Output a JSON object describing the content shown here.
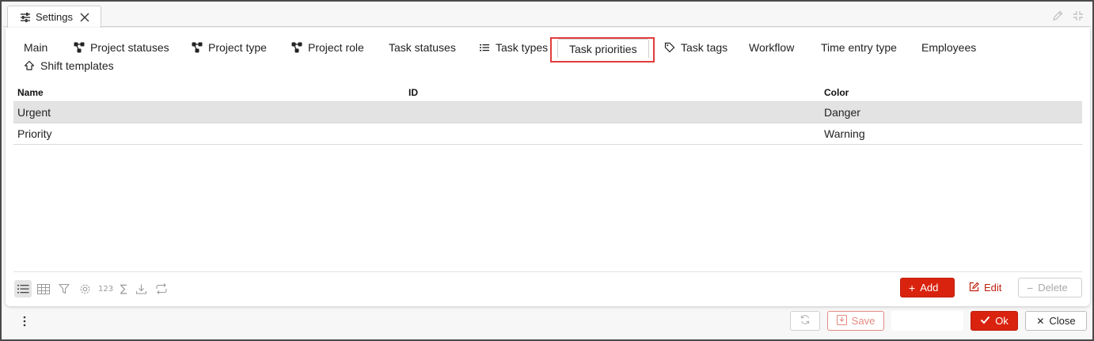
{
  "window": {
    "tab_title": "Settings"
  },
  "settings_tabs": [
    {
      "label": "Main",
      "icon": "none"
    },
    {
      "label": "Project statuses",
      "icon": "hierarchy-icon"
    },
    {
      "label": "Project type",
      "icon": "hierarchy-icon"
    },
    {
      "label": "Project role",
      "icon": "hierarchy-icon"
    },
    {
      "label": "Task statuses",
      "icon": "none"
    },
    {
      "label": "Task types",
      "icon": "list-icon"
    },
    {
      "label": "Task priorities",
      "icon": "none",
      "active": true
    },
    {
      "label": "Task tags",
      "icon": "tag-icon"
    },
    {
      "label": "Workflow",
      "icon": "none"
    },
    {
      "label": "Time entry type",
      "icon": "none"
    },
    {
      "label": "Employees",
      "icon": "none"
    },
    {
      "label": "Shift templates",
      "icon": "shape-icon"
    }
  ],
  "grid": {
    "columns": [
      "Name",
      "ID",
      "Color"
    ],
    "rows": [
      {
        "name": "Urgent",
        "id": "",
        "color": "Danger",
        "selected": true
      },
      {
        "name": "Priority",
        "id": "",
        "color": "Warning",
        "selected": false
      }
    ]
  },
  "toolbar": {
    "numeric_label": "123",
    "sum_label": "∑",
    "add_label": "Add",
    "edit_label": "Edit",
    "delete_label": "Delete"
  },
  "footer": {
    "save_label": "Save",
    "ok_label": "Ok",
    "close_label": "Close"
  },
  "colors": {
    "accent": "#d9230f",
    "highlight_outline": "#e23b3b",
    "selected_row": "#e3e3e3"
  }
}
